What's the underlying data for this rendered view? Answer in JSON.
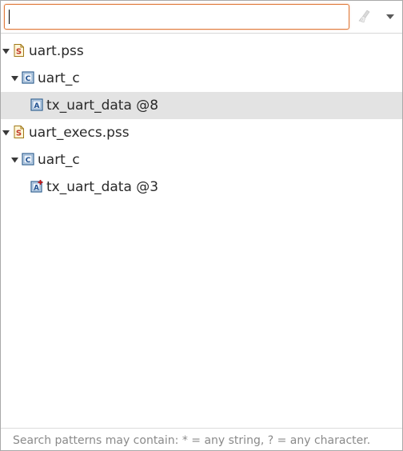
{
  "filter": {
    "value": "",
    "placeholder": ""
  },
  "tree": {
    "nodes": [
      {
        "label": "uart.pss",
        "icon": "pss-file-icon",
        "expanded": true
      },
      {
        "label": "uart_c",
        "icon": "component-icon",
        "expanded": true
      },
      {
        "label": "tx_uart_data @8",
        "icon": "action-icon",
        "selected": true
      },
      {
        "label": "uart_execs.pss",
        "icon": "pss-file-icon",
        "expanded": true
      },
      {
        "label": "uart_c",
        "icon": "component-icon",
        "expanded": true
      },
      {
        "label": "tx_uart_data @3",
        "icon": "action-extension-icon"
      }
    ]
  },
  "status": {
    "hint": "Search patterns may contain: * = any string, ? = any character."
  },
  "colors": {
    "focus_border": "#e07a3a",
    "selection_bg": "#e3e3e3",
    "hint_text": "#8a8a8a"
  }
}
